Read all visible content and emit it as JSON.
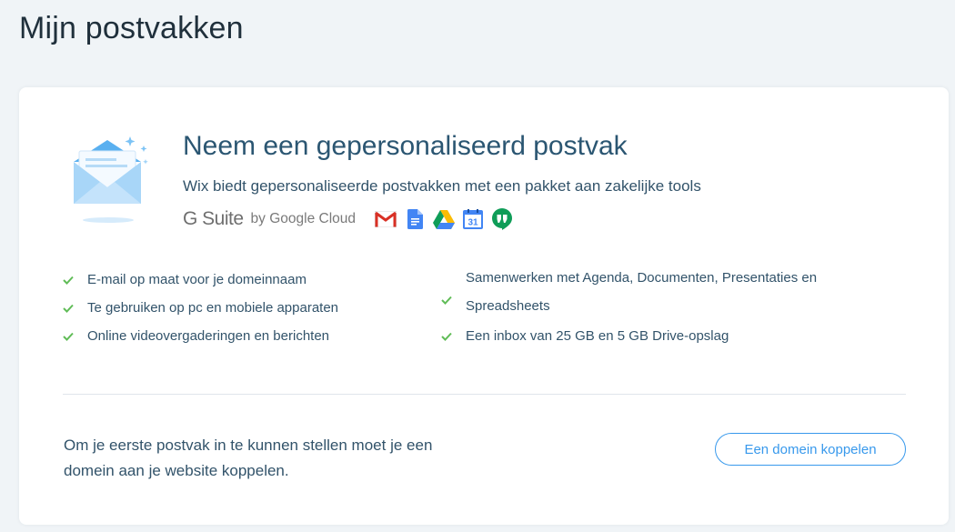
{
  "page": {
    "title": "Mijn postvakken"
  },
  "promo": {
    "title": "Neem een gepersonaliseerd postvak",
    "subtitle": "Wix biedt gepersonaliseerde postvakken met een pakket aan zakelijke tools",
    "brand_logo_text": "G Suite",
    "brand_byline": "by Google Cloud",
    "app_icons": [
      "gmail-icon",
      "google-docs-icon",
      "google-drive-icon",
      "google-calendar-icon",
      "hangouts-icon"
    ],
    "calendar_day": "31"
  },
  "features": {
    "left": [
      "E-mail op maat voor je domeinnaam",
      "Te gebruiken op pc en mobiele apparaten",
      "Online videovergaderingen en berichten"
    ],
    "right_line1": "Samenwerken met Agenda, Documenten, Presentaties en",
    "right_line2": "Spreadsheets",
    "right_last": "Een inbox van 25 GB en 5 GB Drive-opslag"
  },
  "footer": {
    "message": "Om je eerste postvak in te kunnen stellen moet je een domein aan je website koppelen.",
    "button_label": "Een domein koppelen"
  },
  "colors": {
    "background": "#f0f4f7",
    "accent": "#3899ec",
    "check": "#60bc57",
    "title": "#2b5672"
  }
}
